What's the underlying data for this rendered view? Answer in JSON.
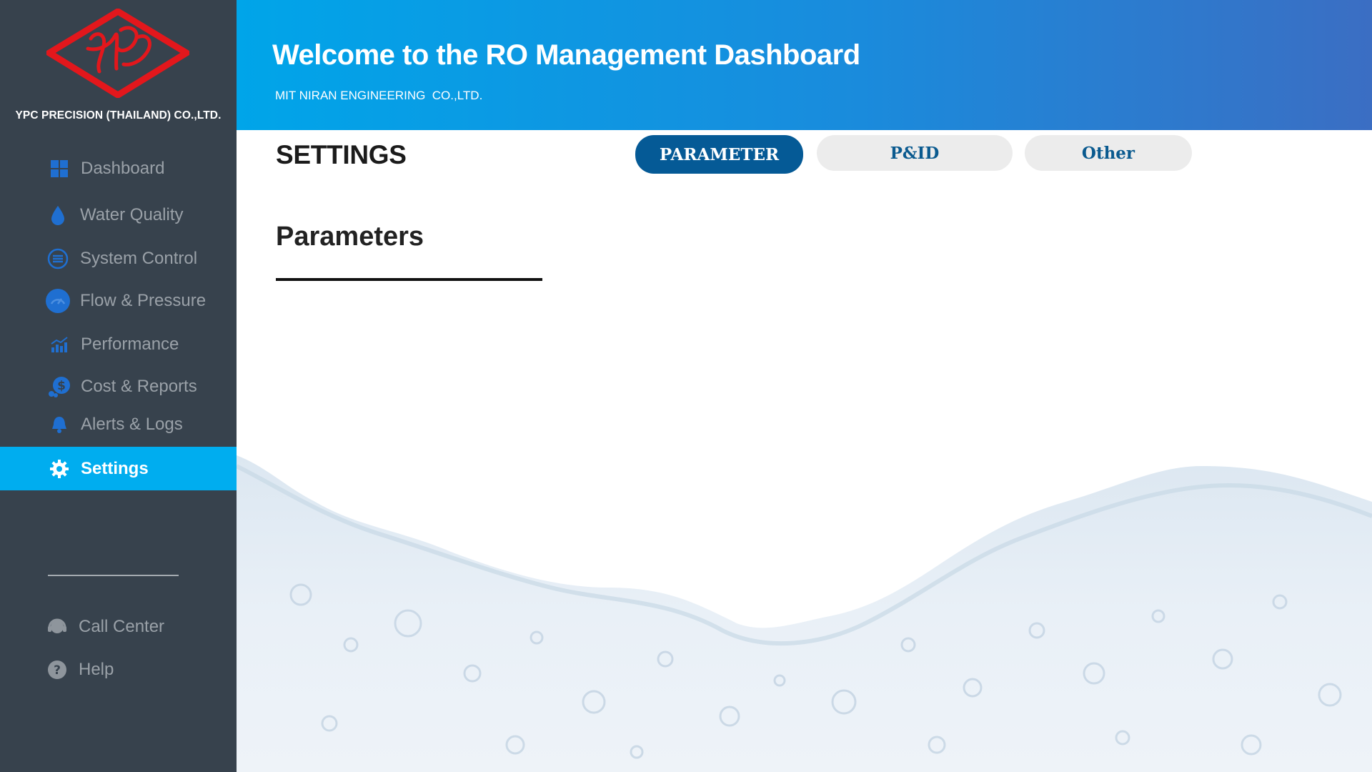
{
  "sidebar": {
    "company": "YPC PRECISION (THAILAND) CO.,LTD.",
    "logo_icon": "ypc-diamond-logo",
    "items": [
      {
        "label": "Dashboard",
        "icon": "dashboard-grid-icon"
      },
      {
        "label": "Water Quality",
        "icon": "water-drop-icon"
      },
      {
        "label": "System Control",
        "icon": "sliders-icon"
      },
      {
        "label": "Flow & Pressure",
        "icon": "gauge-icon"
      },
      {
        "label": "Performance",
        "icon": "chart-trend-icon"
      },
      {
        "label": "Cost & Reports",
        "icon": "dollar-coins-icon"
      },
      {
        "label": "Alerts & Logs",
        "icon": "bell-icon"
      },
      {
        "label": "Settings",
        "icon": "gear-icon",
        "active": true
      }
    ],
    "footer_items": [
      {
        "label": "Call Center",
        "icon": "headset-icon"
      },
      {
        "label": "Help",
        "icon": "question-icon"
      }
    ]
  },
  "header": {
    "title": "Welcome to the RO Management Dashboard",
    "subtitle": "MIT NIRAN ENGINEERING  CO.,LTD."
  },
  "main": {
    "page_title": "SETTINGS",
    "tabs": [
      {
        "label": "PARAMETER",
        "active": true
      },
      {
        "label": "P&ID",
        "active": false
      },
      {
        "label": "Other",
        "active": false
      }
    ],
    "section_title": "Parameters"
  },
  "colors": {
    "sidebar_bg": "#37424d",
    "active_nav": "#00adef",
    "active_tab": "#055a96",
    "icon_blue": "#1f6fd1",
    "logo_red": "#e3171c"
  }
}
